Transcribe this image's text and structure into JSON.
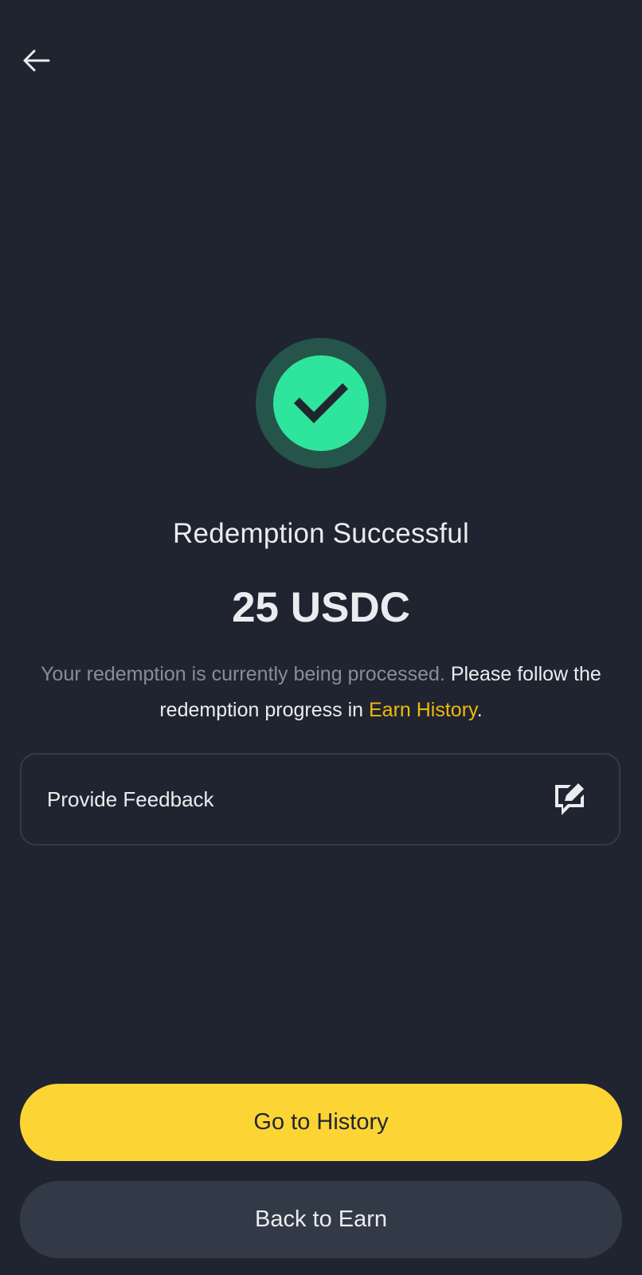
{
  "header": {
    "back_icon": "arrow-left-icon"
  },
  "status": {
    "icon": "check-icon",
    "ring_color": "#24544a",
    "fill_color": "#2fe49d",
    "title": "Redemption Successful",
    "amount": "25 USDC"
  },
  "message": {
    "part_muted": "Your redemption is currently being processed.",
    "part_main": "Please follow the redemption progress in",
    "link_text": "Earn History",
    "end": "."
  },
  "feedback": {
    "label": "Provide Feedback",
    "icon": "feedback-edit-icon"
  },
  "actions": {
    "primary_label": "Go to History",
    "secondary_label": "Back to Earn"
  },
  "colors": {
    "background": "#1f2430",
    "accent": "#fcd535",
    "link": "#f0b90b"
  }
}
